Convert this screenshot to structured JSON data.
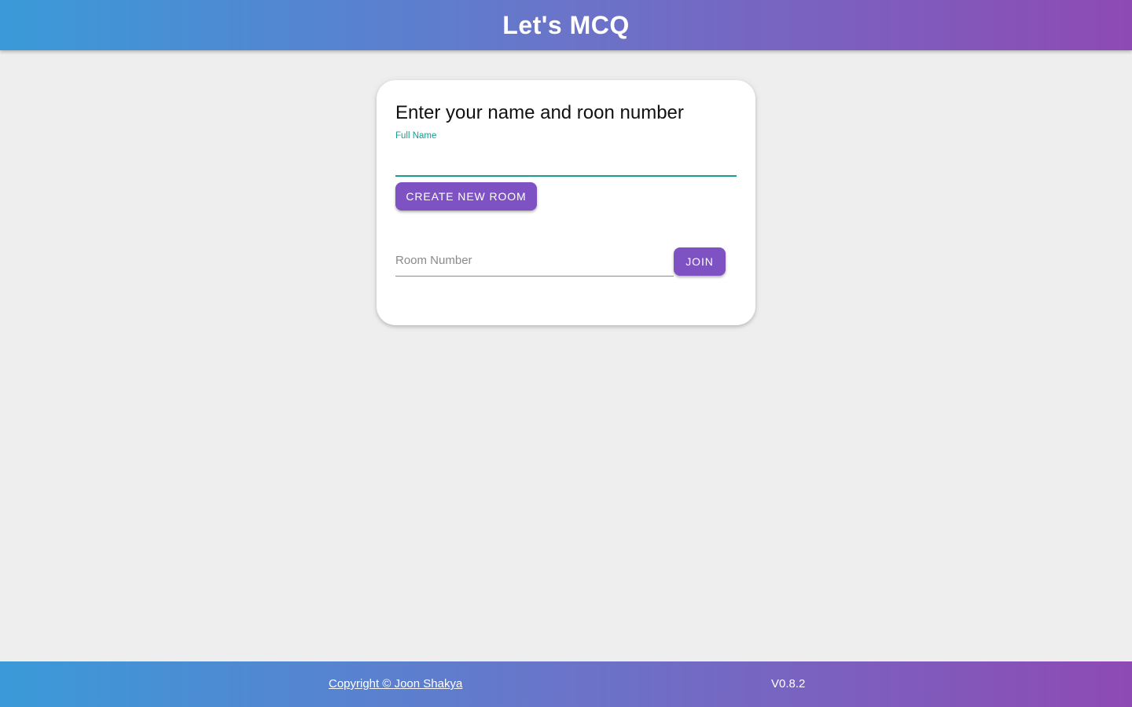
{
  "header": {
    "title": "Let's MCQ"
  },
  "card": {
    "title": "Enter your name and roon number",
    "name_field": {
      "label": "Full Name",
      "value": "",
      "placeholder": ""
    },
    "create_button_label": "CREATE NEW ROOM",
    "room_field": {
      "placeholder": "Room Number",
      "value": ""
    },
    "join_button_label": "JOIN"
  },
  "footer": {
    "copyright": "Copyright © Joon Shakya",
    "version": "V0.8.2"
  },
  "colors": {
    "gradient_start": "#3a9ad9",
    "gradient_end": "#8e4ab4",
    "button": "#7e52c2",
    "accent": "#1a9b8f",
    "background": "#eeeeee"
  }
}
